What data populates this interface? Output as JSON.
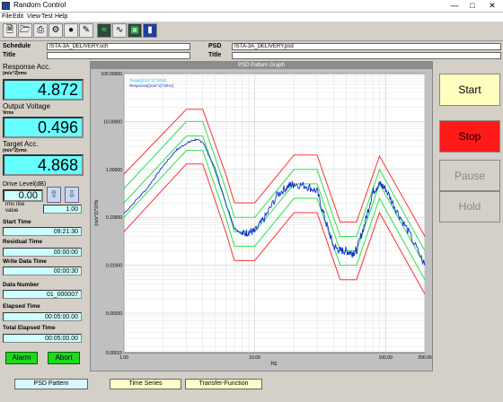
{
  "window": {
    "title": "Random Control"
  },
  "menu": [
    "File",
    "Edit",
    "View",
    "Test",
    "Help"
  ],
  "info": {
    "schedule_label": "Schedule",
    "schedule_value": "ISTA-3A_DELIVERY.sch",
    "title_label": "Title",
    "psd_label": "PSD",
    "psd_value": "ISTA-3A_DELIVERY.psd",
    "psd_title_label": "Title"
  },
  "left": {
    "response_label": "Response Acc.",
    "response_unit": "(m/s^2)rms",
    "response_value": "4.872",
    "output_label": "Output Voltage",
    "output_unit": "Vrms",
    "output_value": "0.496",
    "target_label": "Target Acc.",
    "target_unit": "(m/s^2)rms",
    "target_value": "4.868",
    "drive_label": "Drive Level(dB)",
    "drive_value": "0.00",
    "rms_rise_label": "rms rise",
    "rms_rise_value_label": "value",
    "rms_rise_value": "1.00",
    "start_label": "Start Time",
    "start_value": "09:21:30",
    "residual_label": "Residual Time",
    "residual_value": "00:00:00",
    "write_label": "Write Data Time",
    "write_value": "00:00:30",
    "datanum_label": "Data Number",
    "datanum_value": "01_000007",
    "elapsed_label": "Elapsed Time",
    "elapsed_value": "00:05:00.00",
    "total_label": "Total Elapsed Time",
    "total_value": "00:05:00.00",
    "alarm_label": "Alarm",
    "abort_label": "Abort"
  },
  "graph": {
    "header": "PSD Pattern Graph"
  },
  "right": {
    "start_label": "Start",
    "stop_label": "Stop",
    "pause_label": "Pause",
    "hold_label": "Hold",
    "start_color": "#ffffc0",
    "stop_color": "#ff1a1a"
  },
  "tabs": [
    "PSD Pattern",
    "Time Series",
    "Transfer-Function"
  ],
  "chart_data": {
    "type": "line",
    "title": "",
    "xlabel": "Hz",
    "ylabel": "(m/s^2)^2/Hz",
    "xscale": "log",
    "yscale": "log",
    "xlim": [
      1,
      200
    ],
    "ylim": [
      0.00015,
      100
    ],
    "x_ticks": [
      "1.00",
      "10.00",
      "100.00",
      "200.00"
    ],
    "y_ticks": [
      "100.00000",
      "10.00000",
      "1.00000",
      "0.10000",
      "0.01000",
      "0.00100",
      "0.00015"
    ],
    "legend": [
      "Target[(m/s^2)^2/Hz]",
      "Response[(m/s^2)^2/Hz]"
    ],
    "legend_position": "top-left",
    "grid": true,
    "series": [
      {
        "name": "Target[(m/s^2)^2/Hz]",
        "role": "target",
        "color": "#30e050",
        "x": [
          1,
          3,
          4,
          6,
          7,
          10,
          20,
          30,
          45,
          60,
          90,
          200
        ],
        "y": [
          0.2,
          5.0,
          5.0,
          0.2,
          0.05,
          0.05,
          0.5,
          0.5,
          0.02,
          0.02,
          0.5,
          0.01
        ]
      },
      {
        "name": "Upper Abort",
        "role": "abort-limit",
        "color": "#ff3030",
        "x": [
          1,
          3,
          4,
          6,
          7,
          10,
          20,
          30,
          45,
          60,
          90,
          200
        ],
        "y": [
          0.8,
          18.0,
          18.0,
          0.8,
          0.2,
          0.2,
          2.0,
          2.0,
          0.08,
          0.08,
          1.9,
          0.04
        ]
      },
      {
        "name": "Lower Abort",
        "role": "abort-limit",
        "color": "#ff3030",
        "x": [
          1,
          3,
          4,
          6,
          7,
          10,
          20,
          30,
          45,
          60,
          90,
          200
        ],
        "y": [
          0.05,
          1.3,
          1.3,
          0.05,
          0.0125,
          0.0125,
          0.125,
          0.125,
          0.005,
          0.005,
          0.125,
          0.0025
        ]
      },
      {
        "name": "Upper Alarm",
        "role": "alarm-limit",
        "color": "#30e050",
        "x": [
          1,
          3,
          4,
          6,
          7,
          10,
          20,
          30,
          45,
          60,
          90,
          200
        ],
        "y": [
          0.4,
          10.0,
          10.0,
          0.4,
          0.1,
          0.1,
          1.0,
          1.0,
          0.04,
          0.04,
          1.0,
          0.02
        ]
      },
      {
        "name": "Lower Alarm",
        "role": "alarm-limit",
        "color": "#30e050",
        "x": [
          1,
          3,
          4,
          6,
          7,
          10,
          20,
          30,
          45,
          60,
          90,
          200
        ],
        "y": [
          0.1,
          2.5,
          2.5,
          0.1,
          0.025,
          0.025,
          0.25,
          0.25,
          0.01,
          0.01,
          0.25,
          0.005
        ]
      },
      {
        "name": "Response[(m/s^2)^2/Hz]",
        "role": "response",
        "color": "#1030d0",
        "x": [
          1,
          1.5,
          2,
          2.5,
          3,
          3.5,
          4,
          5,
          6,
          7,
          8,
          9,
          10,
          12,
          15,
          18,
          20,
          25,
          30,
          35,
          40,
          45,
          50,
          55,
          60,
          70,
          80,
          90,
          100,
          120,
          150,
          200
        ],
        "y": [
          0.12,
          0.4,
          1.2,
          2.5,
          3.5,
          4.2,
          3.8,
          1.0,
          0.2,
          0.06,
          0.045,
          0.05,
          0.05,
          0.1,
          0.3,
          0.45,
          0.5,
          0.45,
          0.35,
          0.08,
          0.025,
          0.02,
          0.02,
          0.018,
          0.02,
          0.08,
          0.35,
          0.5,
          0.4,
          0.15,
          0.05,
          0.01
        ]
      }
    ]
  }
}
